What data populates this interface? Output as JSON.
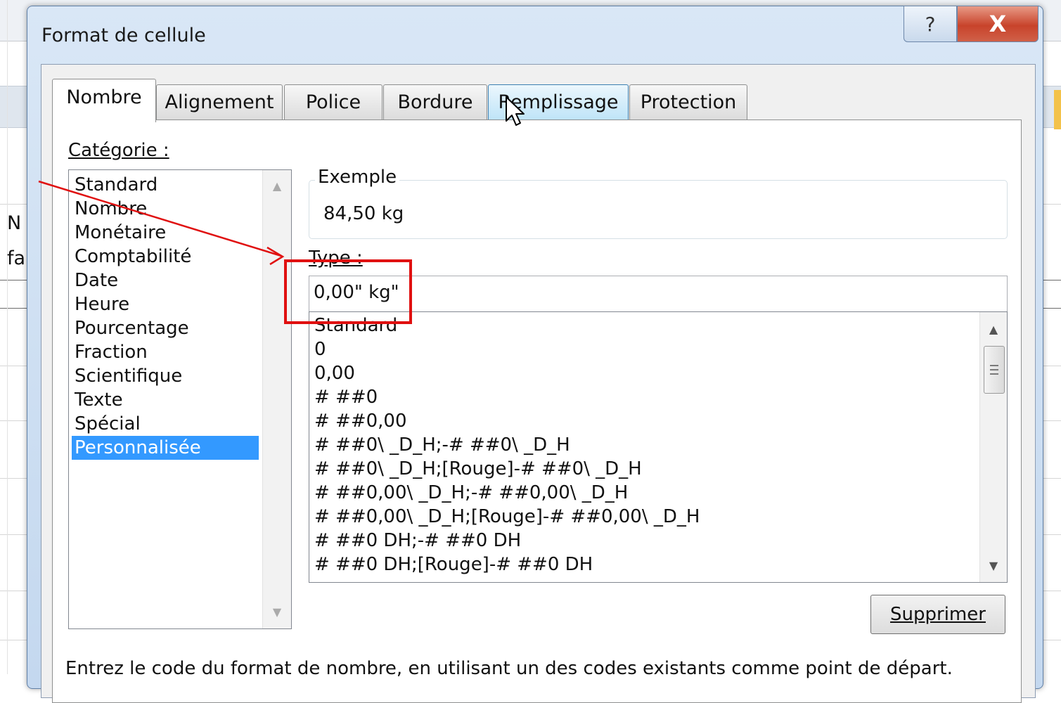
{
  "background_sheet": {
    "cells": [
      "N",
      "fa"
    ]
  },
  "dialog": {
    "title": "Format de cellule",
    "help_glyph": "?",
    "close_glyph": "X"
  },
  "tabs": [
    {
      "label": "Nombre",
      "active": true
    },
    {
      "label": "Alignement"
    },
    {
      "label": "Police"
    },
    {
      "label": "Bordure"
    },
    {
      "label": "Remplissage",
      "hovered": true
    },
    {
      "label": "Protection"
    }
  ],
  "category": {
    "label": "Catégorie :",
    "items": [
      "Standard",
      "Nombre",
      "Monétaire",
      "Comptabilité",
      "Date",
      "Heure",
      "Pourcentage",
      "Fraction",
      "Scientifique",
      "Texte",
      "Spécial",
      "Personnalisée"
    ],
    "selected": "Personnalisée"
  },
  "example": {
    "label": "Exemple",
    "value": "84,50 kg"
  },
  "type": {
    "label": "Type :",
    "value": "0,00\" kg\"",
    "formats": [
      "Standard",
      "0",
      "0,00",
      "# ##0",
      "# ##0,00",
      "# ##0\\ _D_H;-# ##0\\ _D_H",
      "# ##0\\ _D_H;[Rouge]-# ##0\\ _D_H",
      "# ##0,00\\ _D_H;-# ##0,00\\ _D_H",
      "# ##0,00\\ _D_H;[Rouge]-# ##0,00\\ _D_H",
      "# ##0 DH;-# ##0 DH",
      "# ##0 DH;[Rouge]-# ##0 DH"
    ]
  },
  "buttons": {
    "delete": "Supprimer"
  },
  "hint": "Entrez le code du format de nombre, en utilisant un des codes existants comme point de départ.",
  "annotation": {
    "color": "#e01010",
    "target": "type-input"
  },
  "accent_colors": {
    "selection": "#3399ff",
    "close_button": "#c8432b"
  }
}
